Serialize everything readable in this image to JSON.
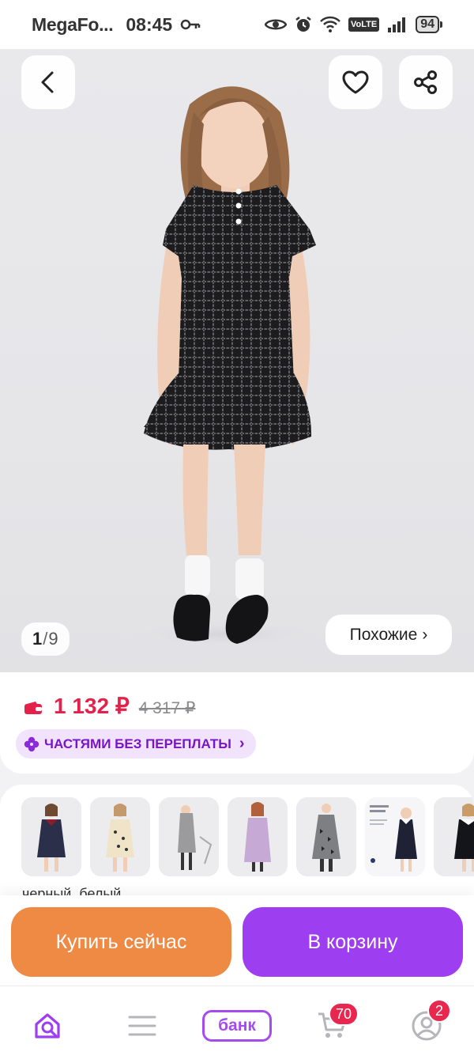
{
  "status_bar": {
    "carrier": "MegaFo...",
    "time": "08:45",
    "network_badge": "VoLTE",
    "battery": "94"
  },
  "gallery": {
    "current": "1",
    "separator": "/",
    "total": "9",
    "similar_label": "Похожие",
    "similar_chevron": "›"
  },
  "price": {
    "current": "1 132 ₽",
    "old": "4 317 ₽",
    "installment_label": "ЧАСТЯМИ БЕЗ ПЕРЕПЛАТЫ",
    "installment_chevron": "›"
  },
  "variants": {
    "color_label": "черный, белый",
    "thumbs": [
      {
        "name": "thumb-navy-dress"
      },
      {
        "name": "thumb-floral-dress"
      },
      {
        "name": "thumb-gray-dress"
      },
      {
        "name": "thumb-lilac-dress"
      },
      {
        "name": "thumb-bow-print-dress"
      },
      {
        "name": "thumb-school-dress"
      },
      {
        "name": "thumb-collar-dress"
      }
    ]
  },
  "actions": {
    "buy_now": "Купить сейчас",
    "add_to_cart": "В корзину"
  },
  "nav": {
    "bank_label": "банк",
    "cart_badge": "70",
    "profile_badge": "2"
  },
  "colors": {
    "price_red": "#e3224c",
    "brand_purple": "#9d3ef0",
    "buy_orange": "#ef8a45"
  }
}
